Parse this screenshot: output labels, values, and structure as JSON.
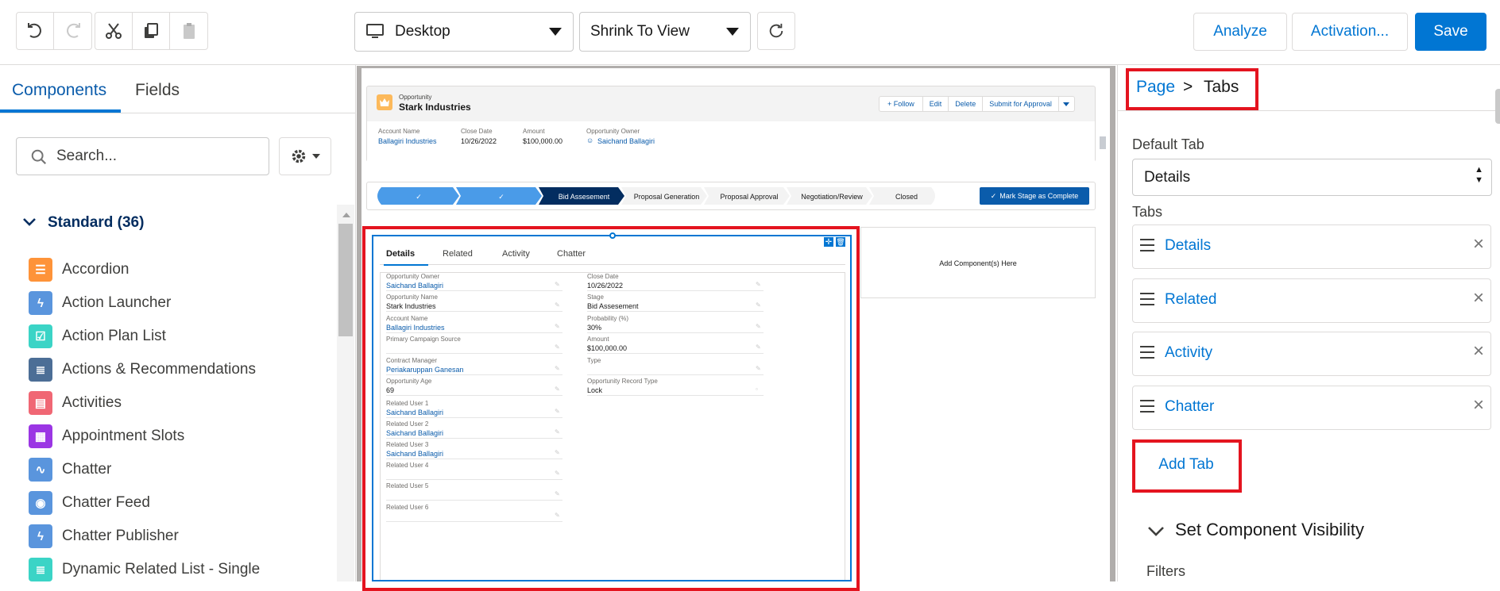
{
  "toolbar": {
    "device": "Desktop",
    "view_mode": "Shrink To View",
    "analyze": "Analyze",
    "activation": "Activation...",
    "save": "Save"
  },
  "left_panel": {
    "tabs": [
      "Components",
      "Fields"
    ],
    "search_placeholder": "Search...",
    "section_title": "Standard (36)",
    "components": [
      {
        "label": "Accordion",
        "icon": "accordion-icon",
        "color": "#fe9339"
      },
      {
        "label": "Action Launcher",
        "icon": "lightning-icon",
        "color": "#5a95dd"
      },
      {
        "label": "Action Plan List",
        "icon": "checklist-icon",
        "color": "#3bd4c6"
      },
      {
        "label": "Actions & Recommendations",
        "icon": "list-icon",
        "color": "#4c6e96"
      },
      {
        "label": "Activities",
        "icon": "clipboard-icon",
        "color": "#f06774"
      },
      {
        "label": "Appointment Slots",
        "icon": "calendar-icon",
        "color": "#9b36e4"
      },
      {
        "label": "Chatter",
        "icon": "pulse-icon",
        "color": "#5a95dd"
      },
      {
        "label": "Chatter Feed",
        "icon": "chat-icon",
        "color": "#5a95dd"
      },
      {
        "label": "Chatter Publisher",
        "icon": "lightning-icon",
        "color": "#5a95dd"
      },
      {
        "label": "Dynamic Related List - Single",
        "icon": "list-icon",
        "color": "#3bd4c6"
      }
    ]
  },
  "record": {
    "object": "Opportunity",
    "name": "Stark Industries",
    "actions": [
      "+ Follow",
      "Edit",
      "Delete",
      "Submit for Approval"
    ],
    "highlights": [
      {
        "label": "Account Name",
        "value": "Ballagiri Industries",
        "link": true
      },
      {
        "label": "Close Date",
        "value": "10/26/2022",
        "link": false
      },
      {
        "label": "Amount",
        "value": "$100,000.00",
        "link": false
      },
      {
        "label": "Opportunity Owner",
        "value": "Saichand Ballagiri",
        "link": true
      }
    ],
    "path": [
      "",
      "",
      "Bid Assesement",
      "Proposal Generation",
      "Proposal Approval",
      "Negotiation/Review",
      "Closed"
    ],
    "mark_complete": "Mark Stage as Complete",
    "add_component": "Add Component(s) Here",
    "tabs": [
      "Details",
      "Related",
      "Activity",
      "Chatter"
    ],
    "left_fields": [
      {
        "label": "Opportunity Owner",
        "value": "Saichand Ballagiri",
        "link": true
      },
      {
        "label": "Opportunity Name",
        "value": "Stark Industries",
        "link": false
      },
      {
        "label": "Account Name",
        "value": "Ballagiri Industries",
        "link": true
      },
      {
        "label": "Primary Campaign Source",
        "value": "",
        "link": false
      },
      {
        "label": "Contract Manager",
        "value": "Periakaruppan Ganesan",
        "link": true
      },
      {
        "label": "Opportunity Age",
        "value": "69",
        "link": false
      },
      {
        "label": "Related User 1",
        "value": "Saichand Ballagiri",
        "link": true
      },
      {
        "label": "Related User 2",
        "value": "Saichand Ballagiri",
        "link": true
      },
      {
        "label": "Related User 3",
        "value": "Saichand Ballagiri",
        "link": true
      },
      {
        "label": "Related User 4",
        "value": "",
        "link": false
      },
      {
        "label": "Related User 5",
        "value": "",
        "link": false
      },
      {
        "label": "Related User 6",
        "value": "",
        "link": false
      }
    ],
    "right_fields": [
      {
        "label": "Close Date",
        "value": "10/26/2022",
        "link": false
      },
      {
        "label": "Stage",
        "value": "Bid Assesement",
        "link": false
      },
      {
        "label": "Probability (%)",
        "value": "30%",
        "link": false
      },
      {
        "label": "Amount",
        "value": "$100,000.00",
        "link": false
      },
      {
        "label": "Type",
        "value": "",
        "link": false
      },
      {
        "label": "Opportunity Record Type",
        "value": "Lock",
        "link": false
      }
    ]
  },
  "right_panel": {
    "breadcrumb_page": "Page",
    "breadcrumb_sep": ">",
    "breadcrumb_current": "Tabs",
    "default_tab_label": "Default Tab",
    "default_tab_value": "Details",
    "tabs_label": "Tabs",
    "tab_rows": [
      "Details",
      "Related",
      "Activity",
      "Chatter"
    ],
    "add_tab": "Add Tab",
    "visibility_title": "Set Component Visibility",
    "filters_label": "Filters"
  },
  "colors": {
    "brand": "#0176d3",
    "highlight": "#e4141f",
    "path_done": "#4a9be8",
    "path_current": "#032d60"
  }
}
